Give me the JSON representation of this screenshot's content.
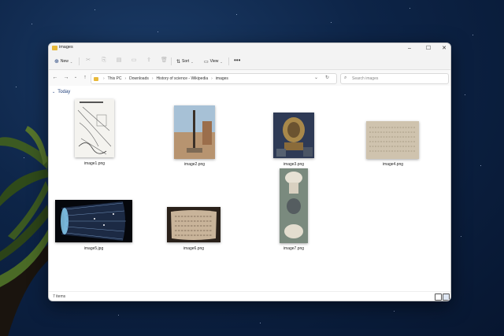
{
  "window": {
    "title": "images"
  },
  "toolbar": {
    "new_label": "New",
    "sort_label": "Sort",
    "view_label": "View",
    "more_label": "•••",
    "icons": [
      "cut-icon",
      "copy-icon",
      "paste-icon",
      "rename-icon",
      "share-icon",
      "delete-icon"
    ]
  },
  "address": {
    "crumbs": [
      "This PC",
      "Downloads",
      "History of science - Wikipedia",
      "images"
    ],
    "search_placeholder": "Search images"
  },
  "group": {
    "label": "Today"
  },
  "files": [
    {
      "name": "image1.png"
    },
    {
      "name": "image2.png"
    },
    {
      "name": "image3.png"
    },
    {
      "name": "image4.png"
    },
    {
      "name": "image5.jpg"
    },
    {
      "name": "image6.png"
    },
    {
      "name": "image7.png"
    }
  ],
  "status": {
    "item_count": "7 items"
  },
  "colors": {
    "folder": "#e8b93a",
    "accent": "#1f3f7a"
  }
}
